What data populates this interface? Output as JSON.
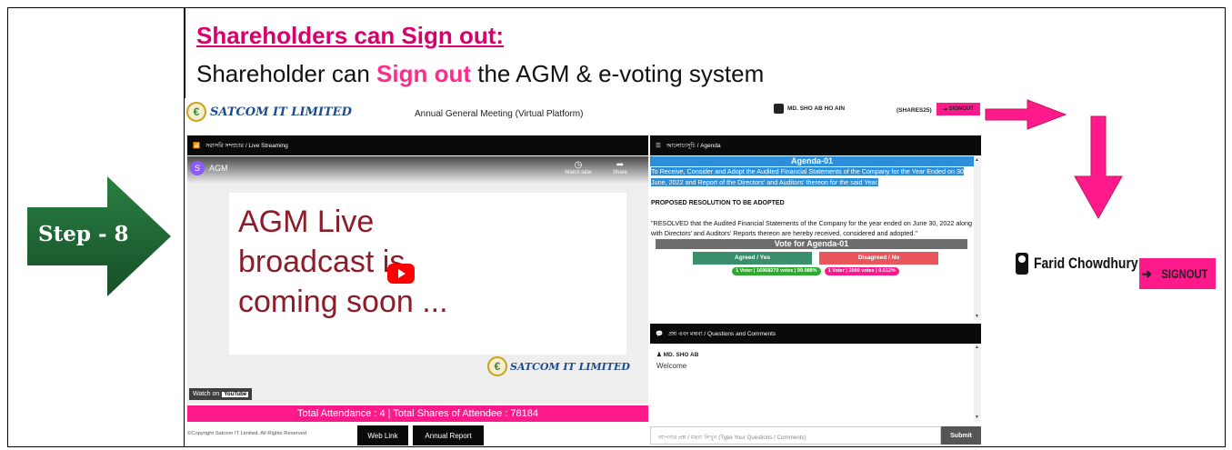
{
  "step": {
    "prefix": "Step - ",
    "number": "8"
  },
  "heading": "Shareholders can Sign out:",
  "subheading": {
    "before": "Shareholder can ",
    "highlight": "Sign out",
    "after": " the AGM & e-voting system"
  },
  "app": {
    "logo_text": "SATCOM IT LIMITED",
    "title": "Annual General Meeting (Virtual Platform)",
    "user_label": "MD. SHO  AB HO   AIN",
    "shares_label": "(SHARES25)",
    "signout_label": "SIGNOUT",
    "live_panel_title": "সরাসরি সম্প্রচার / Live Streaming",
    "agenda_panel_title": "আলোচ্যসূচি / Agenda",
    "video": {
      "channel_initial": "S",
      "title": "AGM",
      "watch_later": "Watch later",
      "share": "Share",
      "slide_lines": [
        "AGM Live",
        "broadcast is",
        "coming soon ..."
      ],
      "slide_logo": "SATCOM IT LIMITED",
      "watch_on": "Watch on",
      "youtube": "YouTube"
    },
    "attendance": "Total Attendance : 4 | Total Shares of Attendee : 78184",
    "agenda": {
      "title": "Agenda-01",
      "text": "To Receive, Consider and Adopt the Audited Financial Statements of the Company for the Year Ended on 30 June, 2022 and Report of the Directors' and Auditors' thereon for the said Year.",
      "resolution_label": "PROPOSED RESOLUTION TO BE ADOPTED",
      "resolution_text": "\"RESOLVED that the Audited Financial Statements of the Company for the year ended on June 30, 2022 along with Directors' and Auditors' Reports thereon are hereby received, considered and adopted.\"",
      "vote_title": "Vote for Agenda-01",
      "agree_label": "Agreed / Yes",
      "disagree_label": "Disagreed / No",
      "agree_count": "1 Voter | 16968270 votes | 99.988%",
      "disagree_count": "1 Voter | 2000 votes | 0.012%",
      "colors": {
        "header": "#2d8fd9",
        "agree": "#3a8f6c",
        "disagree": "#e8555b",
        "agree_count": "#2faa2f",
        "disagree_count": "#ff1a8c"
      }
    },
    "qa": {
      "panel_title": "প্রশ্ন এবং মন্তব্য / Questions and Comments",
      "user": "MD. SHO  AB",
      "message": "Welcome",
      "input_placeholder": "আপনার প্রশ্ন / মন্তব্য লিখুন (Type Your Questions / Comments)",
      "submit_label": "Submit"
    },
    "footer": {
      "copyright": "©Copyright Satcom IT Limited. All Rights Reserved",
      "web_link": "Web Link",
      "annual_report": "Annual Report"
    }
  },
  "callout": {
    "name": "Farid Chowdhury",
    "signout_label": "SIGNOUT",
    "accent_color": "#ff1a8c"
  },
  "colors": {
    "step_arrow": "#1f6b35",
    "heading": "#d9006b",
    "highlight": "#ff2d8a",
    "accent": "#ff1a8c"
  }
}
